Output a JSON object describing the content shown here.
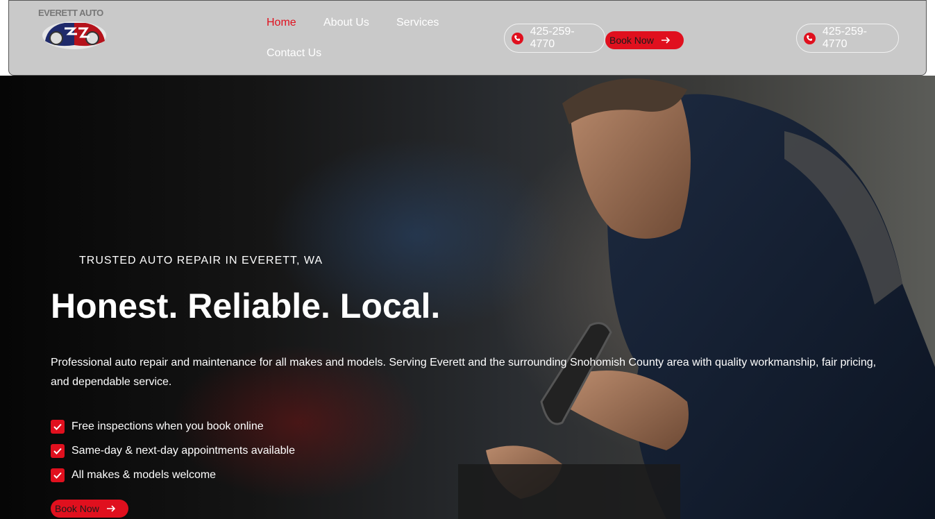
{
  "brand": {
    "logo_text": "EVERETT AUTO"
  },
  "nav": {
    "items": [
      {
        "label": "Home",
        "active": true
      },
      {
        "label": "About Us",
        "active": false
      },
      {
        "label": "Services",
        "active": false
      },
      {
        "label": "Contact Us",
        "active": false
      }
    ]
  },
  "header": {
    "phone_left": "425-259-4770",
    "book_label": "Book Now",
    "phone_right": "425-259-4770"
  },
  "hero": {
    "eyebrow": "TRUSTED AUTO REPAIR IN EVERETT, WA",
    "headline": "Honest. Reliable. Local.",
    "description": "Professional auto repair and maintenance for all makes and models. Serving Everett and the surrounding Snohomish County area with quality workmanship, fair pricing, and dependable service.",
    "checklist": [
      "Free inspections when you book online",
      "Same-day & next-day appointments available",
      "All makes & models welcome"
    ],
    "cta_label": "Book Now"
  },
  "colors": {
    "accent": "#e0101e",
    "header_bg": "#c9c9c9"
  }
}
